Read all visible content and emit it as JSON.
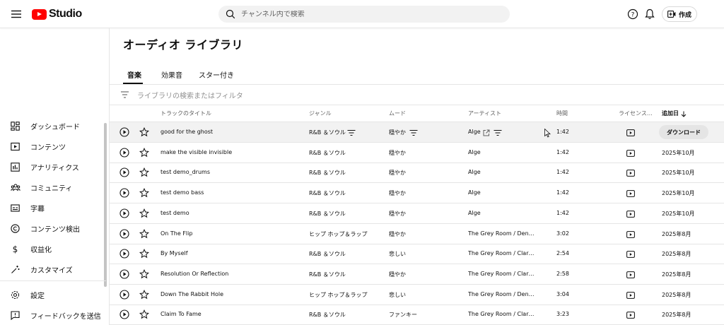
{
  "header": {
    "logo_text": "Studio",
    "search_placeholder": "チャンネル内で検索",
    "create_label": "作成"
  },
  "sidebar": {
    "items": [
      {
        "label": "ダッシュボード",
        "icon": "dashboard-icon"
      },
      {
        "label": "コンテンツ",
        "icon": "content-icon"
      },
      {
        "label": "アナリティクス",
        "icon": "analytics-icon"
      },
      {
        "label": "コミュニティ",
        "icon": "community-icon"
      },
      {
        "label": "字幕",
        "icon": "subtitles-icon"
      },
      {
        "label": "コンテンツ検出",
        "icon": "copyright-icon"
      },
      {
        "label": "収益化",
        "icon": "dollar-icon"
      },
      {
        "label": "カスタマイズ",
        "icon": "magic-wand-icon"
      }
    ],
    "bottom_items": [
      {
        "label": "設定",
        "icon": "gear-icon"
      },
      {
        "label": "フィードバックを送信",
        "icon": "feedback-icon"
      }
    ]
  },
  "main": {
    "title": "オーディオ ライブラリ",
    "tabs": [
      {
        "label": "音楽",
        "active": true
      },
      {
        "label": "効果音",
        "active": false
      },
      {
        "label": "スター付き",
        "active": false
      }
    ],
    "filter_placeholder": "ライブラリの検索またはフィルタ",
    "columns": {
      "title": "トラックのタイトル",
      "genre": "ジャンル",
      "mood": "ムード",
      "artist": "アーティスト",
      "duration": "時間",
      "license": "ライセンス…",
      "added": "追加日"
    },
    "download_label": "ダウンロード",
    "tracks": [
      {
        "title": "good for the ghost",
        "genre": "R&B ＆ソウル",
        "mood": "穏やか",
        "artist": "Alge",
        "duration": "1:42",
        "added": ""
      },
      {
        "title": "make the visible invisible",
        "genre": "R&B ＆ソウル",
        "mood": "穏やか",
        "artist": "Alge",
        "duration": "1:42",
        "added": "2025年10月"
      },
      {
        "title": "test demo_drums",
        "genre": "R&B ＆ソウル",
        "mood": "穏やか",
        "artist": "Alge",
        "duration": "1:42",
        "added": "2025年10月"
      },
      {
        "title": "test demo bass",
        "genre": "R&B ＆ソウル",
        "mood": "穏やか",
        "artist": "Alge",
        "duration": "1:42",
        "added": "2025年10月"
      },
      {
        "title": "test demo",
        "genre": "R&B ＆ソウル",
        "mood": "穏やか",
        "artist": "Alge",
        "duration": "1:42",
        "added": "2025年10月"
      },
      {
        "title": "On The Flip",
        "genre": "ヒップ ホップ＆ラップ",
        "mood": "穏やか",
        "artist": "The Grey Room / Densit…",
        "duration": "3:02",
        "added": "2025年8月"
      },
      {
        "title": "By Myself",
        "genre": "R&B ＆ソウル",
        "mood": "悲しい",
        "artist": "The Grey Room / Clark S…",
        "duration": "2:54",
        "added": "2025年8月"
      },
      {
        "title": "Resolution Or Reflection",
        "genre": "R&B ＆ソウル",
        "mood": "穏やか",
        "artist": "The Grey Room / Clark S…",
        "duration": "2:58",
        "added": "2025年8月"
      },
      {
        "title": "Down The Rabbit Hole",
        "genre": "ヒップ ホップ＆ラップ",
        "mood": "悲しい",
        "artist": "The Grey Room / Densit…",
        "duration": "3:04",
        "added": "2025年8月"
      },
      {
        "title": "Claim To Fame",
        "genre": "R&B ＆ソウル",
        "mood": "ファンキー",
        "artist": "The Grey Room / Clark S…",
        "duration": "3:23",
        "added": "2025年8月"
      }
    ]
  }
}
